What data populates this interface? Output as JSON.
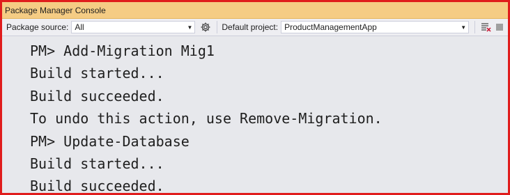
{
  "window": {
    "title": "Package Manager Console"
  },
  "toolbar": {
    "package_source_label": "Package source:",
    "package_source_value": "All",
    "default_project_label": "Default project:",
    "default_project_value": "ProductManagementApp"
  },
  "icons": {
    "settings": "gear-icon",
    "clear": "clear-console-icon",
    "stop": "stop-icon"
  },
  "console": {
    "lines": [
      "PM> Add-Migration Mig1",
      "Build started...",
      "Build succeeded.",
      "To undo this action, use Remove-Migration.",
      "PM> Update-Database",
      "Build started...",
      "Build succeeded."
    ]
  }
}
